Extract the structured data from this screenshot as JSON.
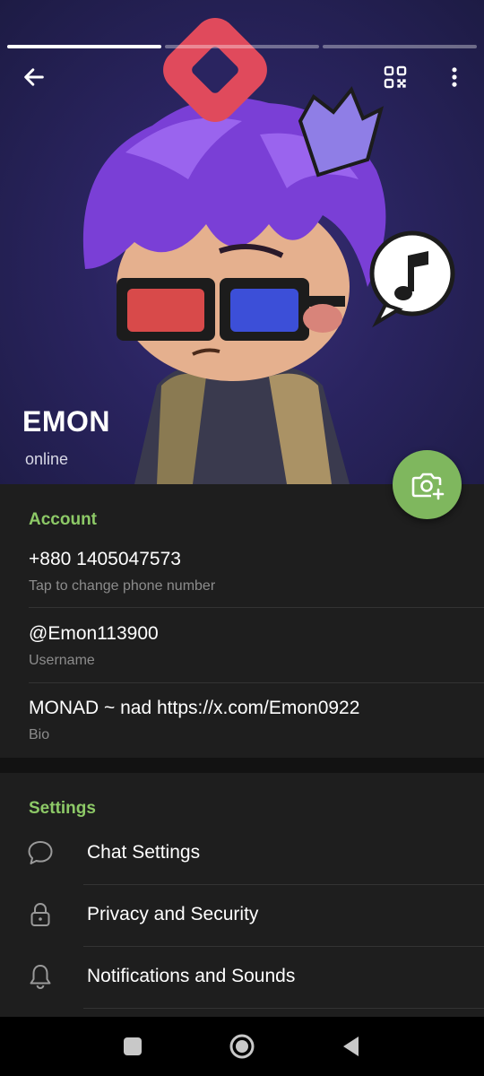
{
  "story": {
    "segments_total": 3,
    "active_segment": 1
  },
  "header": {
    "back_icon": "arrow-left-icon",
    "qr_icon": "qr-code-icon",
    "more_icon": "more-vertical-icon",
    "name": "EMON",
    "status": "online",
    "camera_icon": "add-photo-icon"
  },
  "account": {
    "title": "Account",
    "phone": "+880 1405047573",
    "phone_hint": "Tap to change phone number",
    "username": "@Emon113900",
    "username_hint": "Username",
    "bio": "MONAD ~ nad https://x.com/Emon0922",
    "bio_hint": "Bio"
  },
  "settings": {
    "title": "Settings",
    "items": [
      {
        "label": "Chat Settings",
        "icon": "chat-bubble-icon"
      },
      {
        "label": "Privacy and Security",
        "icon": "lock-icon"
      },
      {
        "label": "Notifications and Sounds",
        "icon": "bell-icon"
      }
    ]
  },
  "navbar": {
    "recents_icon": "square-icon",
    "home_icon": "circle-icon",
    "back_icon": "triangle-back-icon"
  },
  "colors": {
    "accent": "#8dc967",
    "fab": "#7fb75e",
    "background": "#1e1e1e",
    "header_bg": "#2a2460"
  }
}
